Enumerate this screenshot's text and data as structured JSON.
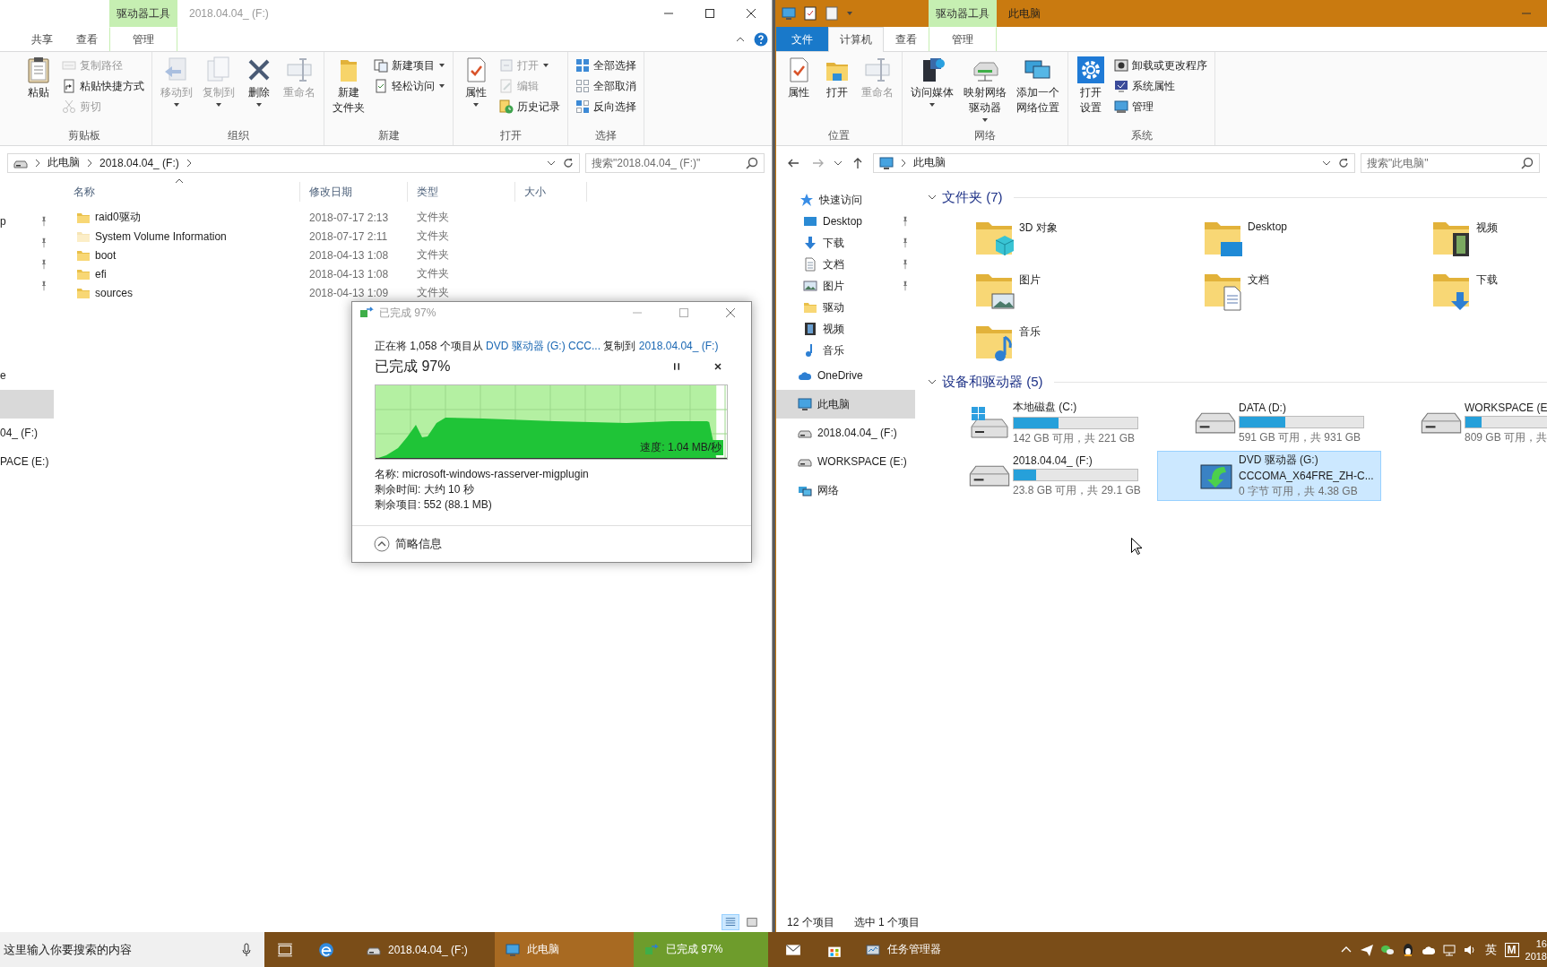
{
  "left_window": {
    "title": "2018.04.04_ (F:)",
    "active": false,
    "tabs": [
      {
        "label": "共享",
        "kind": "normal",
        "selected": false
      },
      {
        "label": "查看",
        "kind": "normal",
        "selected": false
      },
      {
        "label": "管理",
        "kind": "normal",
        "selected": false,
        "context_label": "驱动器工具"
      }
    ],
    "ribbon_groups": [
      {
        "label": "剪贴板",
        "items": [
          {
            "kind": "large",
            "label": "粘贴",
            "disabled": false,
            "dropdown": false
          },
          {
            "kind": "column",
            "commands": [
              {
                "label": "复制路径",
                "disabled": true,
                "dropdown": false
              },
              {
                "label": "粘贴快捷方式",
                "disabled": false,
                "dropdown": false
              },
              {
                "label": "剪切",
                "disabled": true,
                "dropdown": false
              }
            ]
          }
        ]
      },
      {
        "label": "组织",
        "items": [
          {
            "kind": "large",
            "label": "移动到",
            "disabled": true,
            "dropdown": true
          },
          {
            "kind": "large",
            "label": "复制到",
            "disabled": true,
            "dropdown": true
          },
          {
            "kind": "large",
            "label": "删除",
            "disabled": false,
            "dropdown": true
          },
          {
            "kind": "large",
            "label": "重命名",
            "disabled": true,
            "dropdown": false
          }
        ]
      },
      {
        "label": "新建",
        "items": [
          {
            "kind": "large",
            "lines": [
              "新建",
              "文件夹"
            ],
            "disabled": false,
            "dropdown": false
          },
          {
            "kind": "column",
            "commands": [
              {
                "label": "新建项目",
                "disabled": false,
                "dropdown": true
              },
              {
                "label": "轻松访问",
                "disabled": false,
                "dropdown": true
              }
            ]
          }
        ]
      },
      {
        "label": "打开",
        "items": [
          {
            "kind": "large",
            "label": "属性",
            "disabled": false,
            "dropdown": true
          },
          {
            "kind": "column",
            "commands": [
              {
                "label": "打开",
                "disabled": true,
                "dropdown": true
              },
              {
                "label": "编辑",
                "disabled": true,
                "dropdown": false
              },
              {
                "label": "历史记录",
                "disabled": false,
                "dropdown": false
              }
            ]
          }
        ]
      },
      {
        "label": "选择",
        "items": [
          {
            "kind": "column",
            "commands": [
              {
                "label": "全部选择",
                "disabled": false,
                "dropdown": false
              },
              {
                "label": "全部取消",
                "disabled": false,
                "dropdown": false
              },
              {
                "label": "反向选择",
                "disabled": false,
                "dropdown": false
              }
            ]
          }
        ]
      }
    ],
    "address": {
      "crumbs": [
        "此电脑",
        "2018.04.04_ (F:)"
      ]
    },
    "search": {
      "placeholder": "搜索\"2018.04.04_ (F:)\""
    },
    "navigation": [
      {
        "items": [
          {
            "label": "p",
            "pinned": true,
            "selected": false
          },
          {
            "pinned": true,
            "selected": false
          },
          {
            "pinned": true,
            "selected": false
          },
          {
            "pinned": true,
            "selected": false
          }
        ]
      },
      {
        "items": [
          {
            "label": "e",
            "pinned": false,
            "selected": false
          },
          {
            "pinned": false,
            "selected": true
          },
          {
            "label": "04_ (F:)",
            "pinned": false,
            "selected": false
          },
          {
            "label": "PACE (E:)",
            "pinned": false,
            "selected": false
          }
        ]
      }
    ],
    "columns": [
      "名称",
      "修改日期",
      "类型",
      "大小"
    ],
    "files": [
      {
        "name": "raid0驱动",
        "modified": "2018-07-17 2:13",
        "type": "文件夹",
        "hidden": false
      },
      {
        "name": "System Volume Information",
        "modified": "2018-07-17 2:11",
        "type": "文件夹",
        "hidden": true
      },
      {
        "name": "boot",
        "modified": "2018-04-13 1:08",
        "type": "文件夹",
        "hidden": false
      },
      {
        "name": "efi",
        "modified": "2018-04-13 1:08",
        "type": "文件夹",
        "hidden": false
      },
      {
        "name": "sources",
        "modified": "2018-04-13 1:09",
        "type": "文件夹",
        "hidden": false
      }
    ],
    "view_buttons": [
      {
        "selected": true
      },
      {
        "selected": false
      }
    ]
  },
  "copy_dialog": {
    "title": "已完成 97%",
    "message": [
      {
        "kind": "text",
        "text": "正在将 1,058 个项目从 "
      },
      {
        "kind": "link",
        "text": "DVD 驱动器 (G:) CCC..."
      },
      {
        "kind": "text",
        "text": " 复制到 "
      },
      {
        "kind": "link",
        "text": "2018.04.04_ (F:)"
      }
    ],
    "heading": "已完成 97%",
    "level": 0.97,
    "speed": "速度: 1.04 MB/秒",
    "details": [
      "名称: microsoft-windows-rasserver-migplugin",
      "剩余时间: 大约 10 秒",
      "剩余项目: 552 (88.1 MB)"
    ],
    "toggle": "简略信息"
  },
  "right_window": {
    "title": "此电脑",
    "active": true,
    "tabs": [
      {
        "label": "文件",
        "kind": "file",
        "selected": false
      },
      {
        "label": "计算机",
        "kind": "normal",
        "selected": true
      },
      {
        "label": "查看",
        "kind": "normal",
        "selected": false
      },
      {
        "label": "管理",
        "kind": "normal",
        "selected": false,
        "context_label": "驱动器工具"
      }
    ],
    "ribbon_groups": [
      {
        "label": "位置",
        "items": [
          {
            "kind": "large",
            "label": "属性",
            "disabled": false,
            "dropdown": false
          },
          {
            "kind": "large",
            "label": "打开",
            "disabled": false,
            "dropdown": false
          },
          {
            "kind": "large",
            "label": "重命名",
            "disabled": true,
            "dropdown": false
          }
        ]
      },
      {
        "label": "网络",
        "items": [
          {
            "kind": "large",
            "label": "访问媒体",
            "disabled": false,
            "dropdown": true
          },
          {
            "kind": "large",
            "lines": [
              "映射网络",
              "驱动器"
            ],
            "disabled": false,
            "dropdown": true
          },
          {
            "kind": "large",
            "lines": [
              "添加一个",
              "网络位置"
            ],
            "disabled": false,
            "dropdown": false
          }
        ]
      },
      {
        "label": "系统",
        "items": [
          {
            "kind": "large",
            "lines": [
              "打开",
              "设置"
            ],
            "disabled": false,
            "dropdown": false
          },
          {
            "kind": "column",
            "commands": [
              {
                "label": "卸载或更改程序",
                "disabled": false,
                "dropdown": false
              },
              {
                "label": "系统属性",
                "disabled": false,
                "dropdown": false
              },
              {
                "label": "管理",
                "disabled": false,
                "dropdown": false
              }
            ]
          }
        ]
      }
    ],
    "address": {
      "crumbs": [
        "此电脑"
      ]
    },
    "search": {
      "placeholder": "搜索\"此电脑\""
    },
    "navigation": [
      {
        "items": [
          {
            "label": "快速访问",
            "pinned": false,
            "selected": false
          },
          {
            "label": "Desktop",
            "pinned": true,
            "selected": false
          },
          {
            "label": "下载",
            "pinned": true,
            "selected": false
          },
          {
            "label": "文档",
            "pinned": true,
            "selected": false
          },
          {
            "label": "图片",
            "pinned": true,
            "selected": false
          },
          {
            "label": "驱动",
            "pinned": false,
            "selected": false
          },
          {
            "label": "视频",
            "pinned": false,
            "selected": false
          },
          {
            "label": "音乐",
            "pinned": false,
            "selected": false
          }
        ]
      },
      {
        "items": [
          {
            "label": "OneDrive",
            "pinned": false,
            "selected": false
          },
          {
            "label": "此电脑",
            "pinned": false,
            "selected": true
          },
          {
            "label": "2018.04.04_ (F:)",
            "pinned": false,
            "selected": false
          },
          {
            "label": "WORKSPACE (E:)",
            "pinned": false,
            "selected": false
          },
          {
            "label": "网络",
            "pinned": false,
            "selected": false
          }
        ]
      }
    ],
    "folders": {
      "header": "文件夹 (7)",
      "expanded": true,
      "items": [
        "3D 对象",
        "Desktop",
        "视频",
        "图片",
        "文档",
        "下载",
        "音乐"
      ]
    },
    "devices": {
      "header": "设备和驱动器 (5)",
      "expanded": true,
      "items": [
        {
          "kind": "disk",
          "label": "本地磁盘 (C:)",
          "detail": "142 GB 可用，共 221 GB",
          "level": 0.36,
          "selected": false
        },
        {
          "kind": "disk",
          "label": "DATA (D:)",
          "detail": "591 GB 可用，共 931 GB",
          "level": 0.37,
          "selected": false
        },
        {
          "kind": "disk",
          "label": "WORKSPACE (E",
          "detail": "809 GB 可用，共",
          "level": 0.13,
          "selected": false
        },
        {
          "kind": "disk",
          "label": "2018.04.04_ (F:)",
          "detail": "23.8 GB 可用，共 29.1 GB",
          "level": 0.18,
          "selected": false
        },
        {
          "kind": "optical",
          "label": "DVD 驱动器 (G:)",
          "volume": "CCCOMA_X64FRE_ZH-C...",
          "detail": "0 字节 可用，共 4.38 GB",
          "selected": true
        }
      ]
    },
    "status": [
      "12 个项目",
      "选中 1 个项目"
    ]
  },
  "taskbar": {
    "search": {
      "placeholder": "这里输入你要搜索的内容"
    },
    "items": [
      {
        "kind": "icon"
      },
      {
        "kind": "icon"
      },
      {
        "kind": "window",
        "label": "2018.04.04_ (F:)",
        "selected": false
      },
      {
        "kind": "window",
        "label": "此电脑",
        "selected": true
      },
      {
        "kind": "window",
        "label": "已完成 97%",
        "selected": false,
        "level": 0.97
      },
      {
        "kind": "icon"
      },
      {
        "kind": "icon"
      },
      {
        "kind": "window",
        "label": "任务管理器",
        "selected": false
      }
    ],
    "tray": {
      "language": "英",
      "ime": "M",
      "clock": [
        "16",
        "2018"
      ]
    }
  }
}
